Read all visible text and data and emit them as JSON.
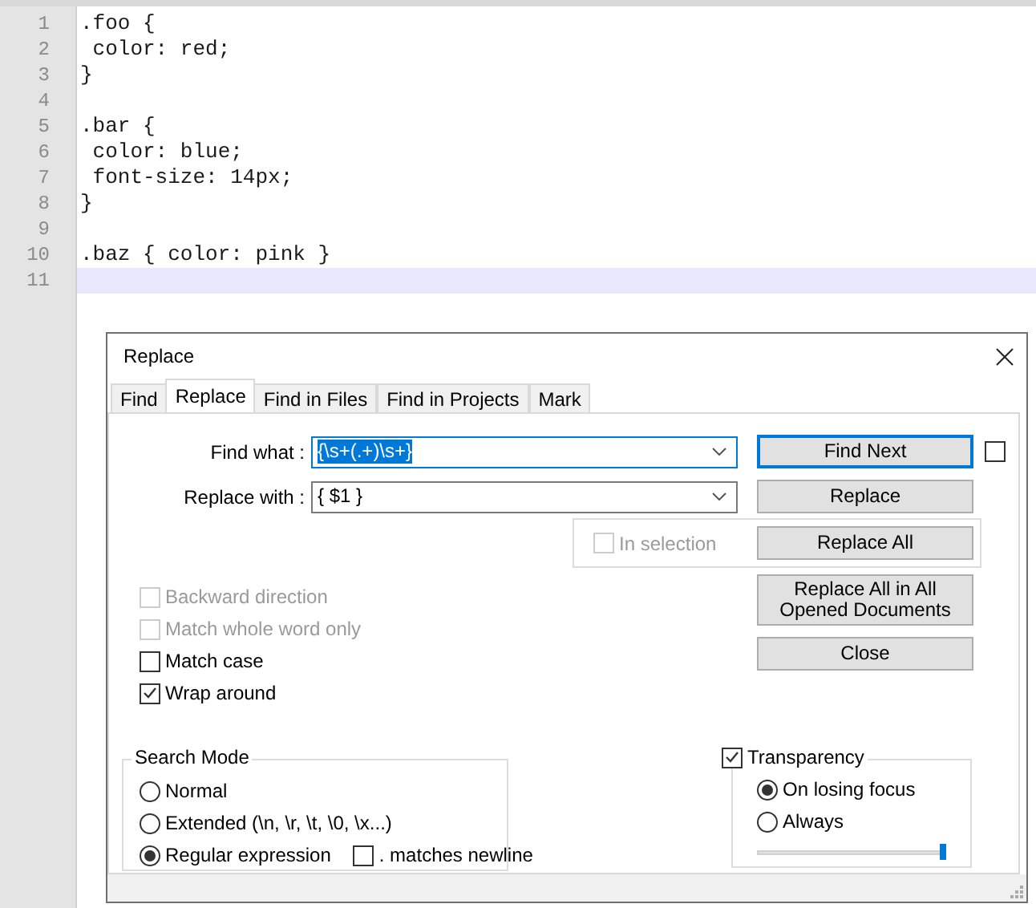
{
  "editor": {
    "lines": [
      {
        "number": "1",
        "text": ".foo {",
        "current": false
      },
      {
        "number": "2",
        "text": " color: red;",
        "current": false
      },
      {
        "number": "3",
        "text": "}",
        "current": false
      },
      {
        "number": "4",
        "current": false
      },
      {
        "number": "5",
        "text": ".bar {",
        "current": false
      },
      {
        "number": "6",
        "text": " color: blue;",
        "current": false
      },
      {
        "number": "7",
        "text": " font-size: 14px;",
        "current": false
      },
      {
        "number": "8",
        "text": "}",
        "current": false
      },
      {
        "number": "9",
        "current": false
      },
      {
        "number": "10",
        "text": ".baz { color: pink }",
        "current": false
      },
      {
        "number": "11",
        "current": true
      }
    ]
  },
  "dialog": {
    "title": "Replace",
    "tabs": [
      {
        "label": "Find",
        "selected": false
      },
      {
        "label": "Replace",
        "selected": true
      },
      {
        "label": "Find in Files",
        "selected": false
      },
      {
        "label": "Find in Projects",
        "selected": false
      },
      {
        "label": "Mark",
        "selected": false
      }
    ],
    "find_what": {
      "label": "Find what :",
      "value": "{\\s+(.+)\\s+}",
      "focused": true,
      "selected": true
    },
    "replace_with": {
      "label": "Replace with :",
      "value": "{ $1 }",
      "focused": false,
      "selected": false
    },
    "find_next": {
      "label": "Find Next",
      "default": true
    },
    "find_next_checkbox": {
      "checked": false
    },
    "replace": {
      "label": "Replace",
      "default": false
    },
    "in_selection": {
      "label": "In selection",
      "checked": false,
      "disabled": true
    },
    "replace_all": {
      "label": "Replace All",
      "default": false
    },
    "replace_all_opened": {
      "label": "Replace All in All Opened Documents",
      "default": false
    },
    "close": {
      "label": "Close",
      "default": false
    },
    "options": [
      {
        "label": "Backward direction",
        "checked": false,
        "disabled": true
      },
      {
        "label": "Match whole word only",
        "checked": false,
        "disabled": true
      },
      {
        "label": "Match case",
        "checked": false,
        "disabled": false
      },
      {
        "label": "Wrap around",
        "checked": true,
        "disabled": false
      }
    ],
    "search_mode": {
      "title": "Search Mode",
      "options": [
        {
          "label": "Normal",
          "selected": false
        },
        {
          "label": "Extended (\\n, \\r, \\t, \\0, \\x...)",
          "selected": false
        },
        {
          "label": "Regular expression",
          "selected": true
        }
      ],
      "matches_newline": {
        "label": ". matches newline",
        "checked": false
      }
    },
    "transparency": {
      "label": "Transparency",
      "checked": true,
      "options": [
        {
          "label": "On losing focus",
          "selected": true
        },
        {
          "label": "Always",
          "selected": false
        }
      ],
      "level": 1
    }
  }
}
